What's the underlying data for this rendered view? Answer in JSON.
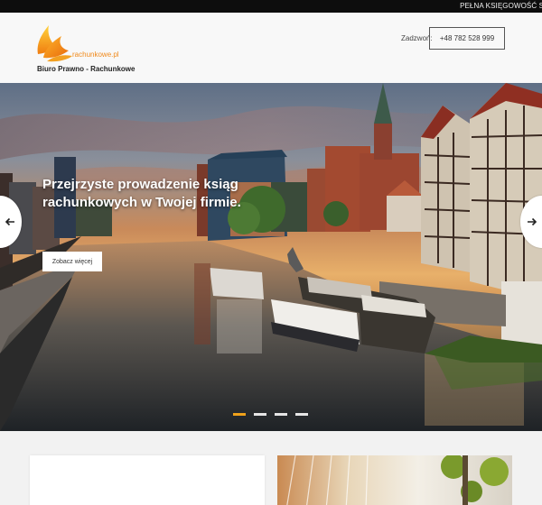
{
  "ticker": {
    "text": "PEŁNA KSIĘGOWOŚĆ S"
  },
  "header": {
    "logo_domain": "rachunkowe.pl",
    "logo_subtitle": "Biuro Prawno - Rachunkowe",
    "call_label": "Zadzwoń:",
    "phone": "+48 782 528 999"
  },
  "hero": {
    "title": "Przejrzyste prowadzenie ksiąg rachunkowych w Twojej firmie.",
    "cta_label": "Zobacz więcej",
    "slide_count": 4,
    "active_slide": 1
  },
  "icons": {
    "prev": "arrow-left-icon",
    "next": "arrow-right-icon",
    "logo": "flame-logo-icon"
  },
  "colors": {
    "accent": "#f0a21b",
    "logo_orange": "#f08a1c",
    "ticker_bg": "#0d0d0d"
  }
}
